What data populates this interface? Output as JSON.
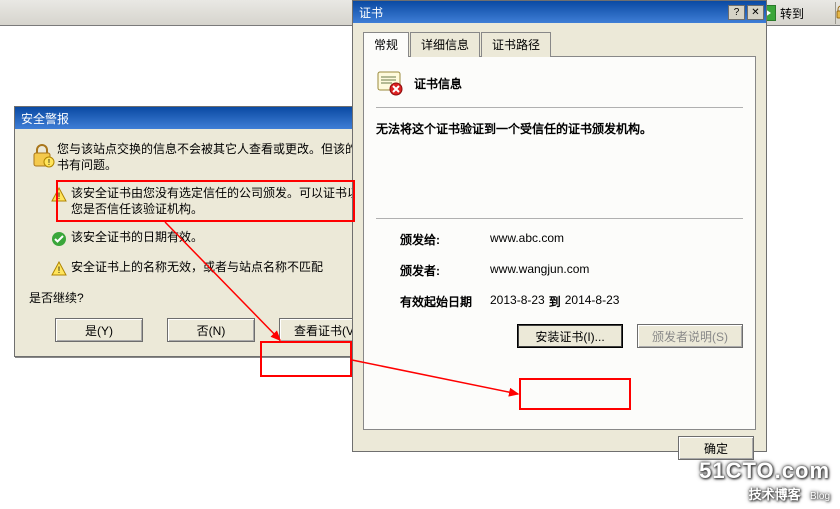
{
  "toolbar": {
    "go_label": "转到"
  },
  "alert": {
    "title": "安全警报",
    "intro": "您与该站点交换的信息不会被其它人查看或更改。但该的安全证书有问题。",
    "untrusted": "该安全证书由您没有选定信任的公司颁发。可以证书以便确定您是否信任该验证机构。",
    "date_valid": "该安全证书的日期有效。",
    "name_mismatch": "安全证书上的名称无效，或者与站点名称不匹配",
    "continue_q": "是否继续?",
    "btn_yes": "是(Y)",
    "btn_no": "否(N)",
    "btn_view": "查看证书(V)"
  },
  "cert": {
    "title": "证书",
    "tabs": {
      "general": "常规",
      "details": "详细信息",
      "path": "证书路径"
    },
    "info_title": "证书信息",
    "warn": "无法将这个证书验证到一个受信任的证书颁发机构。",
    "labels": {
      "issued_to": "颁发给:",
      "issuer": "颁发者:",
      "valid_from": "有效起始日期",
      "to_word": "到"
    },
    "values": {
      "issued_to": "www.abc.com",
      "issuer": "www.wangjun.com",
      "from_date": "2013-8-23",
      "to_date": "2014-8-23"
    },
    "btn_install": "安装证书(I)...",
    "btn_issuer_stmt": "颁发者说明(S)",
    "btn_ok": "确定"
  },
  "watermark": {
    "main": "51CTO.com",
    "sub": "技术博客",
    "blog": "Blog"
  }
}
